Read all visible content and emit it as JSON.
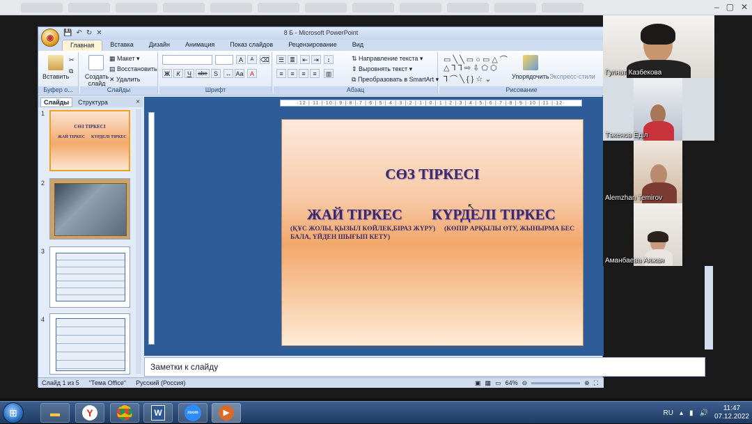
{
  "window": {
    "title": "8 Б - Microsoft PowerPoint"
  },
  "quick_access": [
    "💾",
    "↶",
    "↻",
    "✕"
  ],
  "ribbon": {
    "tabs": [
      "Главная",
      "Вставка",
      "Дизайн",
      "Анимация",
      "Показ слайдов",
      "Рецензирование",
      "Вид"
    ],
    "active_tab": "Главная",
    "groups": {
      "clipboard": {
        "label": "Буфер о...",
        "paste": "Вставить"
      },
      "slides": {
        "label": "Слайды",
        "new_slide": "Создать слайд",
        "layout": "Макет",
        "reset": "Восстановить",
        "delete": "Удалить"
      },
      "font": {
        "label": "Шрифт",
        "bold": "Ж",
        "italic": "К",
        "underline": "Ч",
        "strike": "abe",
        "shadow": "S",
        "grow": "A",
        "shrink": "A"
      },
      "paragraph": {
        "label": "Абзац",
        "text_direction": "Направление текста",
        "align_text": "Выровнять текст",
        "smartart": "Преобразовать в SmartArt"
      },
      "drawing": {
        "label": "Рисование",
        "arrange": "Упорядочить",
        "quick_styles": "Экспресс-стили"
      }
    }
  },
  "panes": {
    "tab_slides": "Слайды",
    "tab_outline": "Структура",
    "close": "×"
  },
  "thumbnails": [
    {
      "num": "1",
      "title": "СӨЗ ТІРКЕСІ",
      "sub1": "ЖАЙ ТІРКЕС",
      "sub2": "КҮРДЕЛІ ТІРКЕС"
    },
    {
      "num": "2"
    },
    {
      "num": "3"
    },
    {
      "num": "4"
    }
  ],
  "ruler_text": "·12·|·11·|·10·|·9·|·8·|·7·|·6·|·5·|·4·|·3·|·2·|·1·|·0·|·1·|·2·|·3·|·4·|·5·|·6·|·7·|·8·|·9·|·10·|·11·|·12·",
  "slide": {
    "title": "СӨЗ ТІРКЕСІ",
    "col1_heading": "ЖАЙ ТІРКЕС",
    "col1_text": "(ҚҰС ЖОЛЫ, ҚЫЗЫЛ КӨЙЛЕК,БІРАЗ ЖҮРУ) БАЛА, ҮЙДЕН ШЫҒЫП КЕТУ)",
    "col2_heading": "КҮРДЕЛІ ТІРКЕС",
    "col2_text": "(КӨПІР АРҚЫЛЫ ӨТУ, ЖЫНЫРМА БЕС"
  },
  "notes_placeholder": "Заметки к слайду",
  "status": {
    "slide": "Слайд 1 из 5",
    "theme": "\"Тема Office\"",
    "language": "Русский (Россия)",
    "zoom": "64%"
  },
  "participants": [
    {
      "name": "Гулнат Казбекова"
    },
    {
      "name": "Төкенов Еділ"
    },
    {
      "name": "Alemzhan Temirov"
    },
    {
      "name": "Аманбаева Аяжан"
    }
  ],
  "taskbar": {
    "lang": "RU",
    "time": "11:47",
    "date": "07.12.2022",
    "zoom_label": "zoom"
  }
}
